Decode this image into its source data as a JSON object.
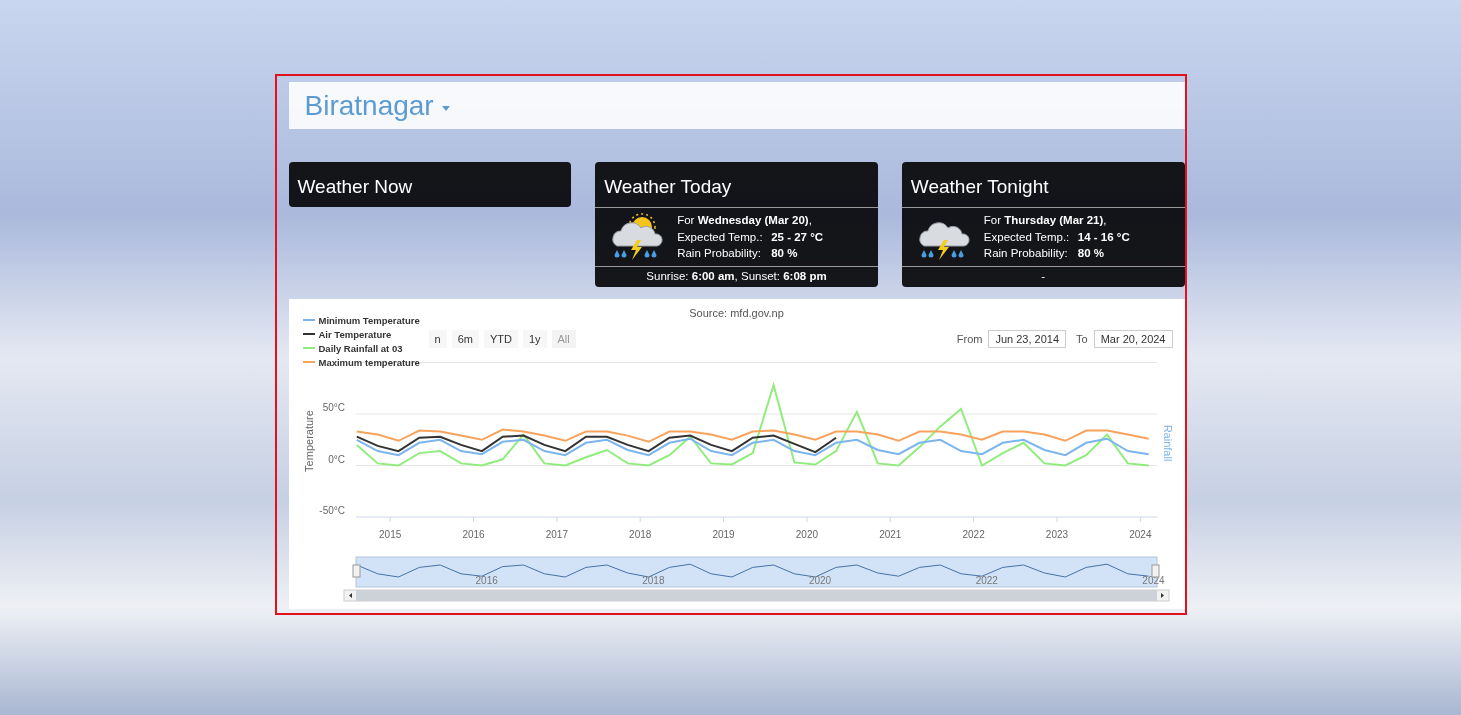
{
  "location": {
    "title": "Biratnagar"
  },
  "cards": [
    {
      "kind": "empty",
      "title": "Weather Now"
    },
    {
      "kind": "forecast",
      "title": "Weather Today",
      "sun": true,
      "day_line": "For **Wednesday (Mar 20)**,",
      "rows": [
        {
          "label": "Expected Temp.:",
          "value": "25 - 27 °C"
        },
        {
          "label": "Rain Probability:",
          "value": "80 %"
        }
      ],
      "footer": "Sunrise: **6:00 am**, Sunset: **6:08 pm**"
    },
    {
      "kind": "forecast",
      "title": "Weather Tonight",
      "sun": false,
      "day_line": "For **Thursday (Mar 21)**,",
      "rows": [
        {
          "label": "Expected Temp.:",
          "value": "14 - 16 °C"
        },
        {
          "label": "Rain Probability:",
          "value": "80 %"
        }
      ],
      "footer": "-"
    }
  ],
  "chart": {
    "source": "Source: mfd.gov.np",
    "range_buttons": [
      {
        "label": "n",
        "disabled": false
      },
      {
        "label": "6m",
        "disabled": false
      },
      {
        "label": "YTD",
        "disabled": false
      },
      {
        "label": "1y",
        "disabled": false
      },
      {
        "label": "All",
        "disabled": true
      }
    ],
    "from_label": "From",
    "from_value": "Jun 23, 2014",
    "to_label": "To",
    "to_value": "Mar 20, 2024",
    "secondary_axis_title": "Rainfall",
    "chart_data": {
      "type": "line",
      "ylabel": "Temperature",
      "x": [
        2014.6,
        2014.85,
        2015.1,
        2015.35,
        2015.6,
        2015.85,
        2016.1,
        2016.35,
        2016.6,
        2016.85,
        2017.1,
        2017.35,
        2017.6,
        2017.85,
        2018.1,
        2018.35,
        2018.6,
        2018.85,
        2019.1,
        2019.35,
        2019.6,
        2019.85,
        2020.1,
        2020.35,
        2020.6,
        2020.85,
        2021.1,
        2021.35,
        2021.6,
        2021.85,
        2022.1,
        2022.35,
        2022.6,
        2022.85,
        2023.1,
        2023.35,
        2023.6,
        2023.85,
        2024.1
      ],
      "series": [
        {
          "name": "Minimum Temperature",
          "color": "#7cb5ec",
          "values": [
            25,
            14,
            10,
            22,
            25,
            14,
            11,
            23,
            25,
            14,
            10,
            22,
            25,
            15,
            10,
            22,
            26,
            14,
            10,
            22,
            25,
            14,
            10,
            22,
            25,
            15,
            11,
            22,
            25,
            14,
            11,
            22,
            25,
            15,
            10,
            22,
            26,
            14,
            11
          ]
        },
        {
          "name": "Air Temperature",
          "color": "#333333",
          "values": [
            28,
            19,
            14,
            27,
            28,
            20,
            14,
            28,
            29,
            20,
            14,
            28,
            28,
            20,
            14,
            27,
            29,
            20,
            14,
            27,
            29,
            21,
            13,
            27,
            null,
            null,
            null,
            null,
            null,
            null,
            null,
            null,
            null,
            null,
            null,
            null,
            null,
            null,
            null
          ]
        },
        {
          "name": "Daily Rainfall at 03",
          "color": "#90ed7d",
          "values": [
            20,
            2,
            0,
            12,
            14,
            2,
            0,
            6,
            30,
            2,
            0,
            8,
            15,
            2,
            0,
            10,
            28,
            2,
            1,
            12,
            78,
            3,
            1,
            14,
            52,
            2,
            0,
            18,
            38,
            55,
            0,
            12,
            22,
            2,
            0,
            10,
            30,
            2,
            0
          ]
        },
        {
          "name": "Maximum temperature",
          "color": "#f7a35c",
          "values": [
            33,
            30,
            24,
            34,
            33,
            29,
            25,
            35,
            33,
            29,
            24,
            33,
            33,
            29,
            23,
            33,
            33,
            30,
            25,
            33,
            34,
            30,
            25,
            33,
            33,
            30,
            24,
            33,
            33,
            30,
            25,
            33,
            33,
            30,
            24,
            34,
            34,
            30,
            26
          ]
        }
      ],
      "xlim": [
        2014.59,
        2024.2
      ],
      "ylim": [
        -50,
        100
      ],
      "xticks": [
        2015,
        2016,
        2017,
        2018,
        2019,
        2020,
        2021,
        2022,
        2023,
        2024
      ],
      "yticks": [
        {
          "value": -50,
          "label": "-50°C"
        },
        {
          "value": 0,
          "label": "0°C"
        },
        {
          "value": 50,
          "label": "50°C"
        }
      ]
    },
    "navigator": {
      "labels": [
        "2016",
        "2018",
        "2020",
        "2022",
        "2024"
      ]
    }
  }
}
